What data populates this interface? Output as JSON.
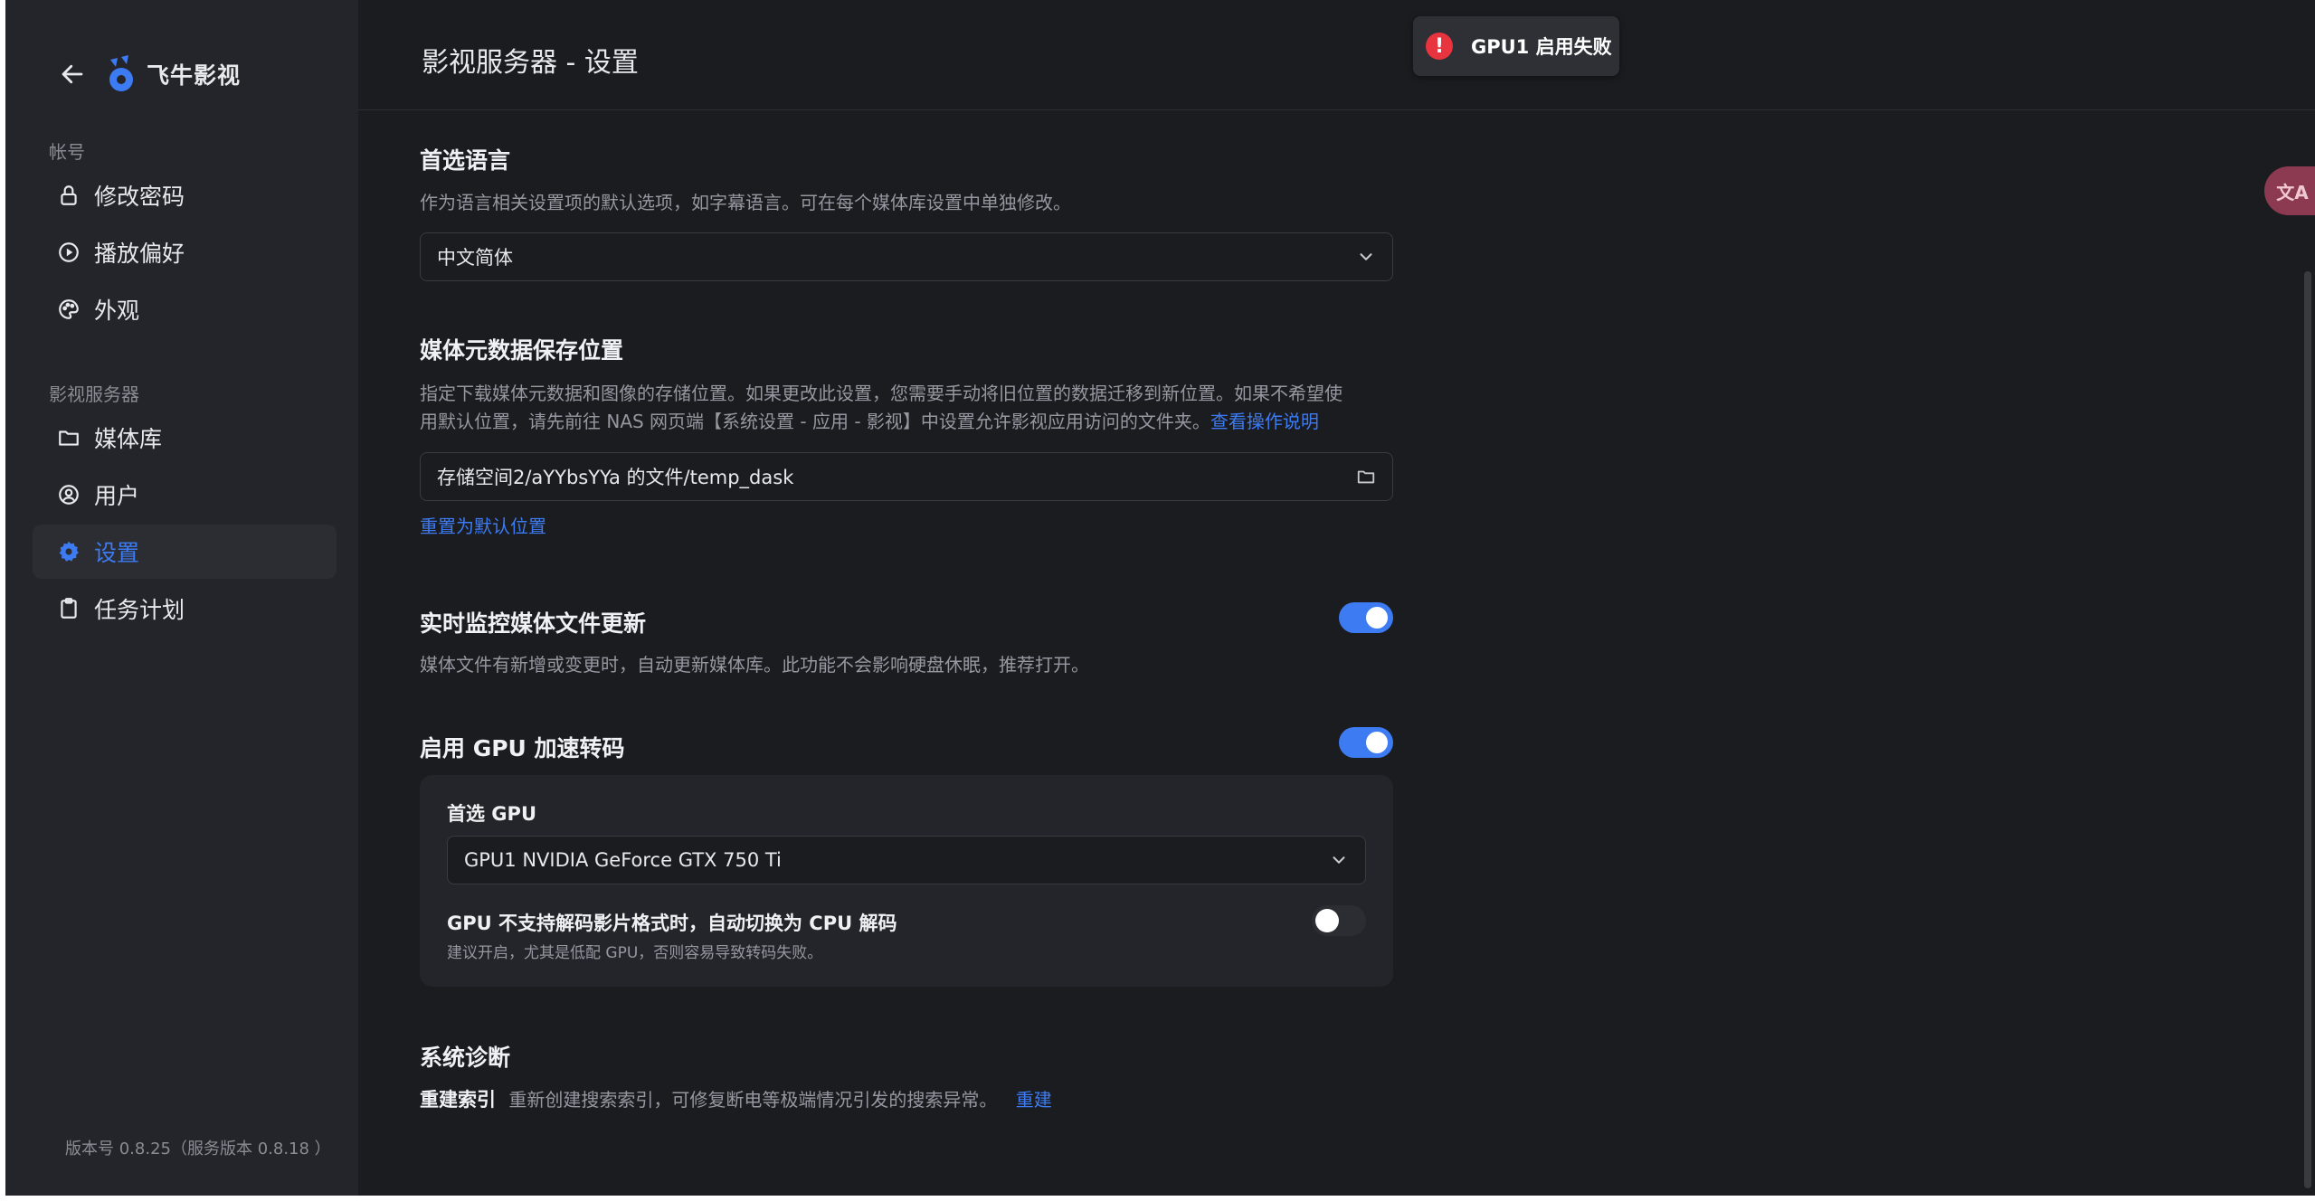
{
  "app": {
    "name": "飞牛影视"
  },
  "sidebar": {
    "sections": [
      {
        "label": "帐号"
      },
      {
        "label": "影视服务器"
      }
    ],
    "items": [
      {
        "label": "修改密码",
        "icon": "lock-icon"
      },
      {
        "label": "播放偏好",
        "icon": "play-circle-icon"
      },
      {
        "label": "外观",
        "icon": "palette-icon"
      },
      {
        "label": "媒体库",
        "icon": "folder-icon"
      },
      {
        "label": "用户",
        "icon": "user-circle-icon"
      },
      {
        "label": "设置",
        "icon": "gear-icon",
        "active": true
      },
      {
        "label": "任务计划",
        "icon": "clipboard-icon"
      }
    ],
    "version": "版本号 0.8.25（服务版本 0.8.18 ）"
  },
  "header": {
    "title": "影视服务器 - 设置"
  },
  "toast": {
    "message": "GPU1 启用失败",
    "icon": "error-icon",
    "color": "#e8343f"
  },
  "settings": {
    "language": {
      "title": "首选语言",
      "desc": "作为语言相关设置项的默认选项，如字幕语言。可在每个媒体库设置中单独修改。",
      "value": "中文简体"
    },
    "metadata": {
      "title": "媒体元数据保存位置",
      "desc_line1": "指定下载媒体元数据和图像的存储位置。如果更改此设置，您需要手动将旧位置的数据迁移到新位置。如果不希望使",
      "desc_line2": "用默认位置，请先前往 NAS 网页端【系统设置 - 应用 - 影视】中设置允许影视应用访问的文件夹。",
      "help_link": "查看操作说明",
      "path": "存储空间2/aYYbsYYa 的文件/temp_dask",
      "reset_link": "重置为默认位置"
    },
    "monitor": {
      "title": "实时监控媒体文件更新",
      "desc": "媒体文件有新增或变更时，自动更新媒体库。此功能不会影响硬盘休眠，推荐打开。",
      "enabled": true
    },
    "gpu": {
      "title": "启用 GPU 加速转码",
      "enabled": true,
      "preferred_label": "首选 GPU",
      "preferred_value": "GPU1 NVIDIA GeForce GTX 750 Ti",
      "fallback_title": "GPU 不支持解码影片格式时，自动切换为 CPU 解码",
      "fallback_desc": "建议开启，尤其是低配 GPU，否则容易导致转码失败。",
      "fallback_enabled": false
    },
    "diagnostics": {
      "title": "系统诊断",
      "rebuild_label": "重建索引",
      "rebuild_desc": "重新创建搜索索引，可修复断电等极端情况引发的搜索异常。",
      "rebuild_link": "重建"
    }
  },
  "colors": {
    "accent": "#3d7bf2",
    "background": "#1b1c20",
    "sidebar": "#24252a"
  }
}
